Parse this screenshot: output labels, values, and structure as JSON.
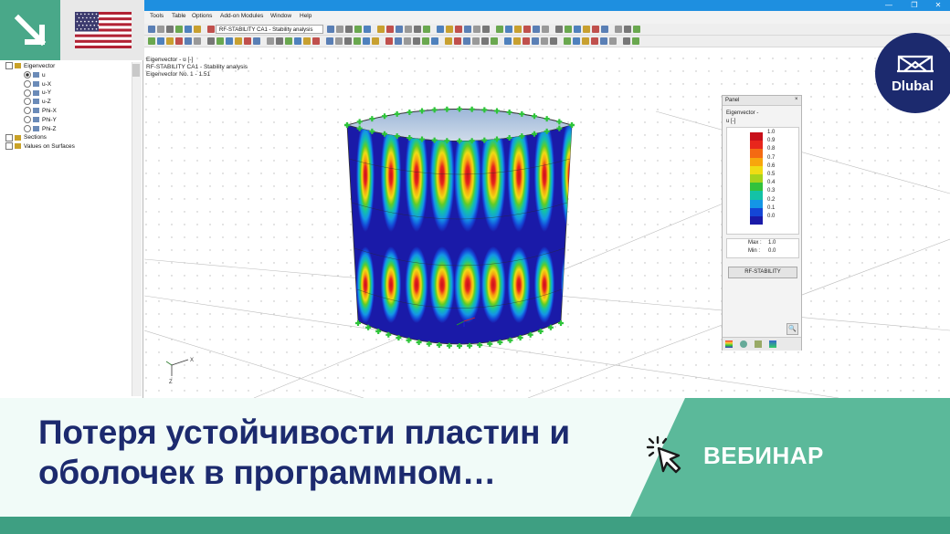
{
  "menu": {
    "items": [
      "Tools",
      "Table",
      "Options",
      "Add-on Modules",
      "Window",
      "Help"
    ]
  },
  "toolbar": {
    "case_combo": "RF-STABILITY CA1 - Stability analysis"
  },
  "tree": {
    "items": [
      {
        "label": "Eigenvector",
        "kind": "check-root"
      },
      {
        "label": "u",
        "kind": "radio",
        "selected": true
      },
      {
        "label": "u-X",
        "kind": "radio"
      },
      {
        "label": "u-Y",
        "kind": "radio"
      },
      {
        "label": "u-Z",
        "kind": "radio"
      },
      {
        "label": "Phi-X",
        "kind": "radio"
      },
      {
        "label": "Phi-Y",
        "kind": "radio"
      },
      {
        "label": "Phi-Z",
        "kind": "radio"
      },
      {
        "label": "Sections",
        "kind": "check"
      },
      {
        "label": "Values on Surfaces",
        "kind": "check"
      }
    ]
  },
  "viewport": {
    "info_line1": "Eigenvector - u [-]",
    "info_line2": "RF-STABILITY CA1 - Stability analysis",
    "info_line3": "Eigenvector No. 1 - 1.51",
    "axis_x": "X",
    "axis_z": "Z"
  },
  "panel": {
    "title": "Panel",
    "heading": "Eigenvector -",
    "unit": "u [-]",
    "legend": [
      {
        "value": "1.0",
        "color": "#c8101a"
      },
      {
        "value": "0.9",
        "color": "#e8261c"
      },
      {
        "value": "0.8",
        "color": "#f46a12"
      },
      {
        "value": "0.7",
        "color": "#f8a60c"
      },
      {
        "value": "0.6",
        "color": "#f0dc14"
      },
      {
        "value": "0.5",
        "color": "#a6d31c"
      },
      {
        "value": "0.4",
        "color": "#32c23c"
      },
      {
        "value": "0.3",
        "color": "#14c2a6"
      },
      {
        "value": "0.2",
        "color": "#1496e6"
      },
      {
        "value": "0.1",
        "color": "#1446d6"
      },
      {
        "value": "0.0",
        "color": "#1a1aa8"
      }
    ],
    "max_label": "Max :",
    "max_value": "1.0",
    "min_label": "Min :",
    "min_value": "0.0",
    "button": "RF-STABILITY"
  },
  "logo": {
    "brand": "Dlubal"
  },
  "banner": {
    "title": "Потеря устойчивости пластин и оболочек в программном…",
    "tag": "ВЕБИНАР"
  },
  "colors": {
    "teal": "#49a889",
    "navy": "#1c2a6e",
    "titlebar": "#1e8fe0"
  }
}
